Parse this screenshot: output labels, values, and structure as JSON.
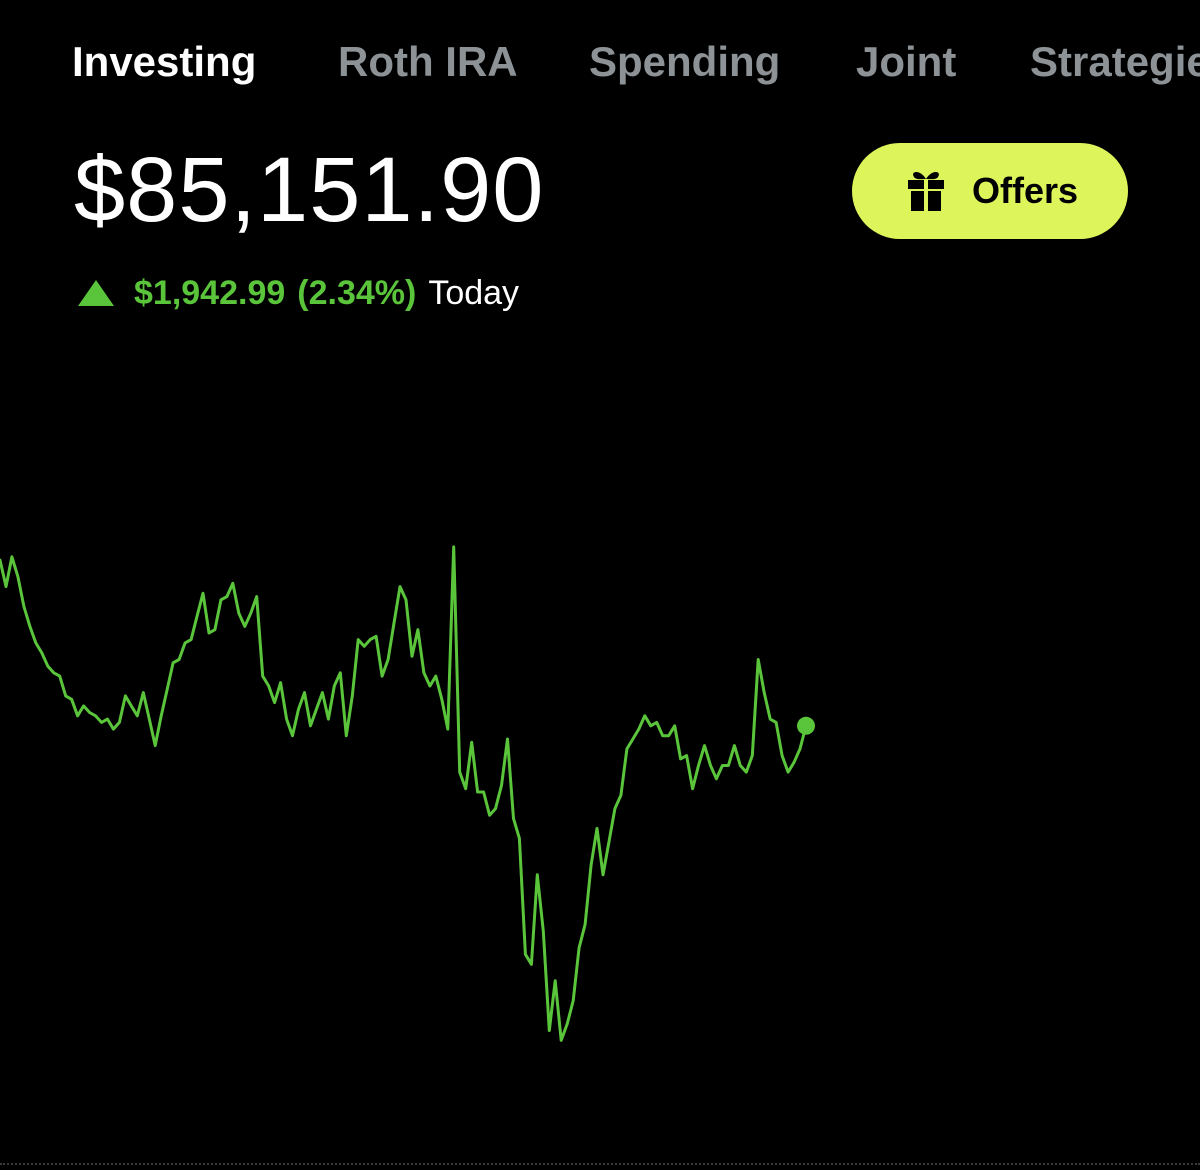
{
  "tabs": [
    {
      "label": "Investing",
      "active": true
    },
    {
      "label": "Roth IRA",
      "active": false
    },
    {
      "label": "Spending",
      "active": false
    },
    {
      "label": "Joint",
      "active": false
    },
    {
      "label": "Strategies",
      "active": false
    }
  ],
  "portfolio": {
    "balance": "$85,151.90",
    "change_amount": "$1,942.99",
    "change_percent": "(2.34%)",
    "change_period": "Today",
    "change_direction": "up"
  },
  "offers_button": {
    "label": "Offers",
    "icon": "gift-icon"
  },
  "colors": {
    "background": "#000000",
    "gain": "#5ac53b",
    "offers_bg": "#ddf55b",
    "tab_inactive": "#8c9296",
    "tab_active": "#ffffff"
  },
  "chart_data": {
    "type": "line",
    "title": "",
    "xlabel": "",
    "ylabel": "",
    "series": [
      {
        "values": [
          84000,
          83840,
          84020,
          83900,
          83720,
          83600,
          83500,
          83440,
          83360,
          83320,
          83300,
          83180,
          83160,
          83060,
          83120,
          83080,
          83060,
          83020,
          83040,
          82980,
          83020,
          83180,
          83120,
          83060,
          83200,
          83040,
          82880,
          83060,
          83220,
          83380,
          83400,
          83500,
          83520,
          83660,
          83800,
          83560,
          83580,
          83760,
          83780,
          83860,
          83680,
          83600,
          83680,
          83780,
          83300,
          83240,
          83140,
          83260,
          83040,
          82940,
          83100,
          83200,
          83000,
          83100,
          83200,
          83040,
          83240,
          83320,
          82940,
          83180,
          83520,
          83480,
          83520,
          83540,
          83300,
          83400,
          83620,
          83840,
          83760,
          83420,
          83580,
          83320,
          83240,
          83300,
          83160,
          82980,
          84080,
          82720,
          82620,
          82900,
          82600,
          82600,
          82460,
          82500,
          82640,
          82920,
          82440,
          82320,
          81620,
          81560,
          82100,
          81760,
          81160,
          81460,
          81100,
          81200,
          81340,
          81660,
          81800,
          82160,
          82380,
          82100,
          82300,
          82500,
          82580,
          82860,
          82920,
          82980,
          83060,
          83000,
          83020,
          82940,
          82940,
          83000,
          82800,
          82820,
          82620,
          82760,
          82880,
          82760,
          82680,
          82760,
          82760,
          82880,
          82760,
          82720,
          82820,
          83400,
          83200,
          83040,
          83020,
          82820,
          82720,
          82780,
          82860,
          83000
        ]
      }
    ],
    "ylim": [
      81000,
      84200
    ],
    "grid": false,
    "legend": "none",
    "end_marker": true,
    "baseline": "dotted"
  }
}
